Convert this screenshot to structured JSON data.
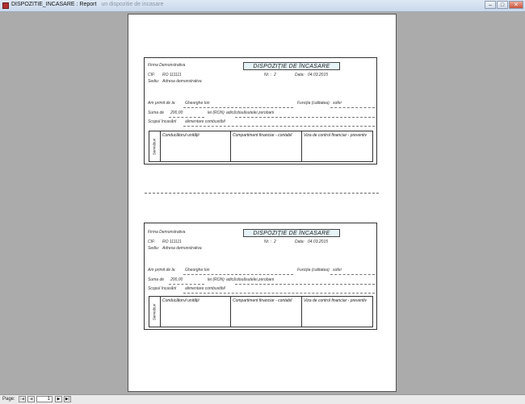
{
  "window": {
    "title": "DISPOZITIE_INCASARE : Report",
    "ghost_text": "un dispozitie de incasare",
    "buttons": {
      "minimize": "–",
      "maximize": "□",
      "close": "✕"
    },
    "app_icon": "report-icon"
  },
  "form": {
    "company": "Firma Demonstrativa",
    "title": "DISPOZIȚIE DE ÎNCASARE",
    "nr_label": "Nr. :",
    "nr_value": "2",
    "date_label": "Data:",
    "date_value": "04.03.2015",
    "cif_label": "CIF:",
    "cif_value": "RO 111111",
    "sediu_label": "Sediu:",
    "sediu_value": "Adresa demonstrativa",
    "received_label": "Am primit de la:",
    "received_value": "Gheorghe Ion",
    "function_label": "Funcția (calitatea)",
    "function_value": "sofer",
    "sum_label": "Suma de",
    "sum_value": "200,00",
    "currency": "lei (RON)",
    "words_label": "adică:",
    "words_value": "douăsutelei,zerobani",
    "purpose_label": "Scopul încasării",
    "purpose_value": "alimentare combustibil",
    "signatures_label": "Semnături",
    "sig_management": "Conducătorul unității",
    "sig_finance": "Compartiment financiar - contabil",
    "sig_control": "Viza de control financiar - preventiv"
  },
  "navbar": {
    "page_label": "Page:",
    "page_value": "1",
    "first": "|◀",
    "prev": "◀",
    "next": "▶",
    "last": "▶|"
  }
}
